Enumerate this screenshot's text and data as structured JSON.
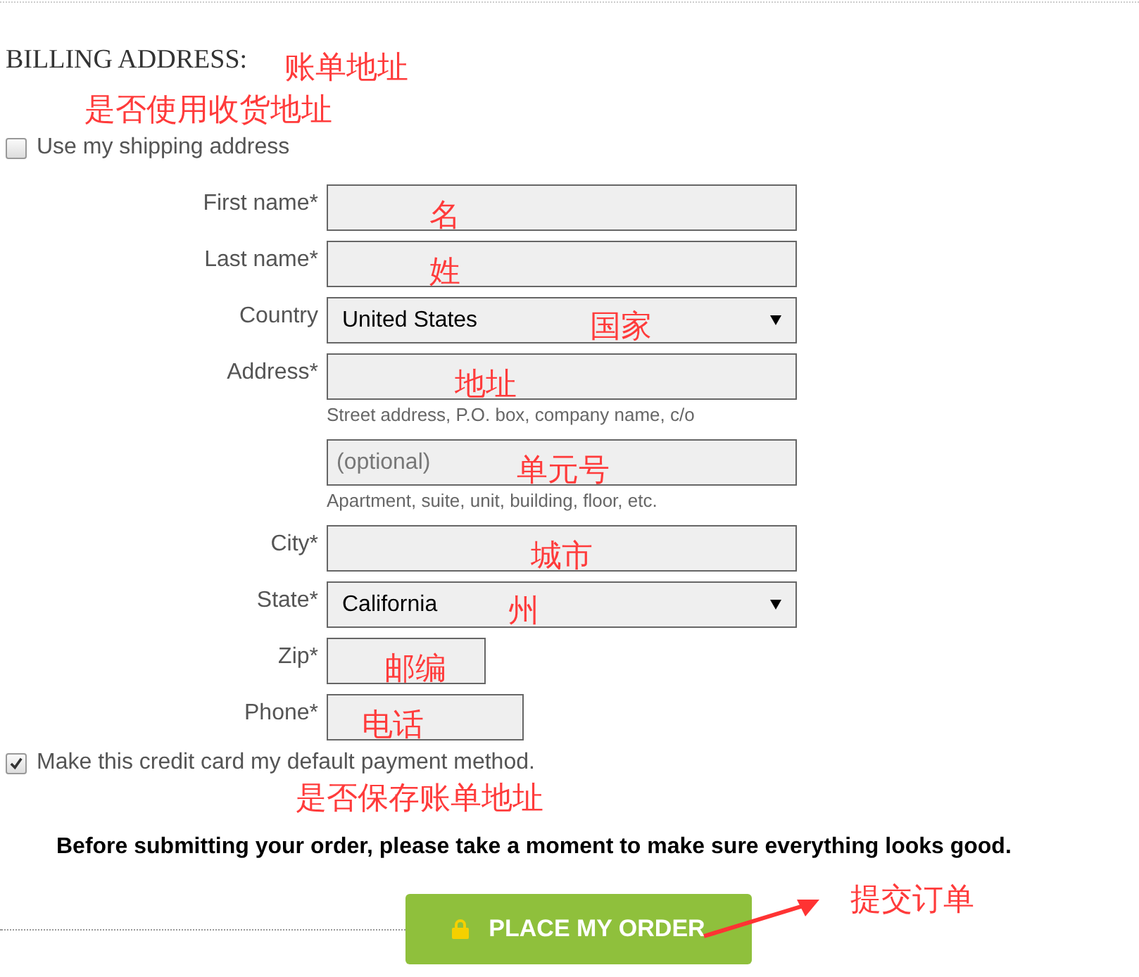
{
  "heading": {
    "text": "BILLING ADDRESS:",
    "note": "账单地址"
  },
  "use_shipping": {
    "label": "Use my shipping address",
    "checked": false,
    "note": "是否使用收货地址"
  },
  "fields": [
    {
      "kind": "text",
      "label": "First name*",
      "note": "名"
    },
    {
      "kind": "text",
      "label": "Last name*",
      "note": "姓"
    },
    {
      "kind": "select",
      "label": "Country",
      "value": "United States",
      "note": "国家"
    },
    {
      "kind": "text",
      "label": "Address*",
      "note": "地址",
      "hint": "Street address, P.O. box, company name, c/o"
    },
    {
      "kind": "text",
      "placeholder": "(optional)",
      "note": "单元号",
      "hint": "Apartment, suite, unit, building, floor, etc."
    },
    {
      "kind": "text",
      "label": "City*",
      "note": "城市"
    },
    {
      "kind": "select",
      "label": "State*",
      "value": "California",
      "note": "州"
    },
    {
      "kind": "text",
      "label": "Zip*",
      "note": "邮编"
    },
    {
      "kind": "text",
      "label": "Phone*",
      "note": "电话"
    }
  ],
  "default_payment": {
    "label": "Make this credit card my default payment method.",
    "checked": true,
    "note": "是否保存账单地址"
  },
  "notice": "Before submitting your order, please take a moment to make sure everything looks good.",
  "order_button": {
    "label": "PLACE MY ORDER",
    "note": "提交订单"
  }
}
